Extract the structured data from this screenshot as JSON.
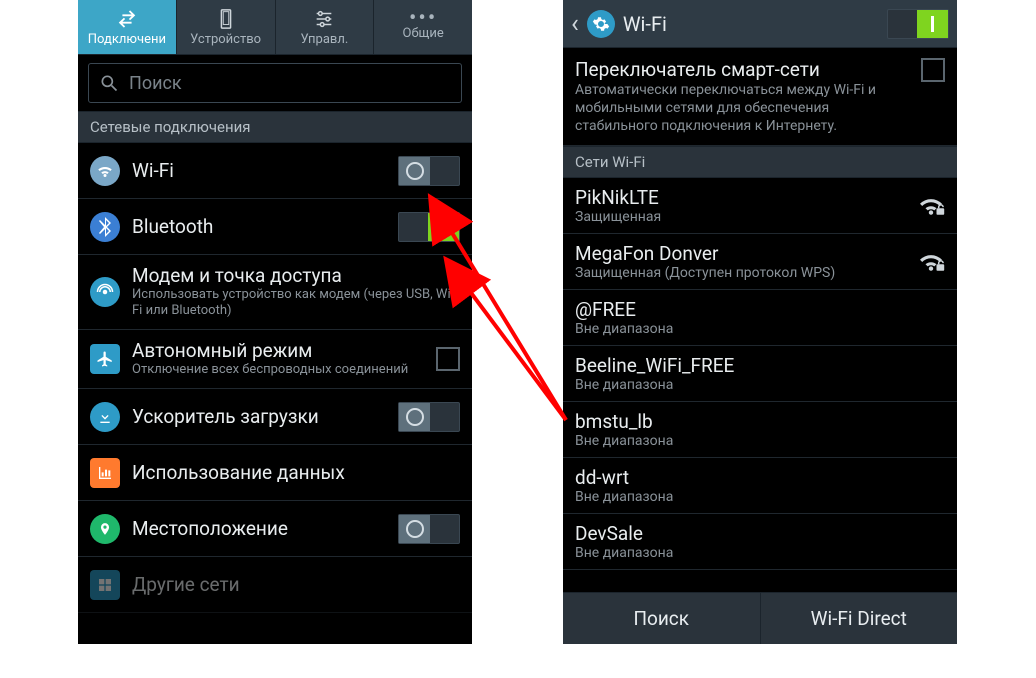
{
  "left": {
    "tabs": [
      {
        "label": "Подключени"
      },
      {
        "label": "Устройство"
      },
      {
        "label": "Управл."
      },
      {
        "label": "Общие"
      }
    ],
    "search_placeholder": "Поиск",
    "section_header": "Сетевые подключения",
    "rows": [
      {
        "title": "Wi-Fi"
      },
      {
        "title": "Bluetooth"
      },
      {
        "title": "Модем и точка доступа",
        "sub": "Использовать устройство как модем (через USB, Wi-Fi или Bluetooth)"
      },
      {
        "title": "Автономный режим",
        "sub": "Отключение всех беспроводных соединений"
      },
      {
        "title": "Ускоритель загрузки"
      },
      {
        "title": "Использование данных"
      },
      {
        "title": "Местоположение"
      },
      {
        "title": "Другие сети"
      }
    ]
  },
  "right": {
    "header_title": "Wi-Fi",
    "smart": {
      "title": "Переключатель смарт-сети",
      "sub": "Автоматически переключаться между Wi-Fi и мобильными сетями для обеспечения стабильного подключения к Интернету."
    },
    "section_header": "Сети Wi-Fi",
    "networks": [
      {
        "name": "PikNikLTE",
        "status": "Защищенная",
        "signal": true
      },
      {
        "name": "MegaFon Donver",
        "status": "Защищенная (Доступен протокол WPS)",
        "signal": true
      },
      {
        "name": "@FREE",
        "status": "Вне диапазона"
      },
      {
        "name": "Beeline_WiFi_FREE",
        "status": "Вне диапазона"
      },
      {
        "name": "bmstu_lb",
        "status": "Вне диапазона"
      },
      {
        "name": "dd-wrt",
        "status": "Вне диапазона"
      },
      {
        "name": "DevSale",
        "status": "Вне диапазона"
      }
    ],
    "bottom": {
      "search": "Поиск",
      "direct": "Wi-Fi Direct"
    }
  },
  "icons": {
    "wifi_circle": "#7aa7c7",
    "bluetooth_circle": "#3b7fd4",
    "tether_circle": "#2e9bc7",
    "airplane_circle": "#2e9bc7",
    "boost_circle": "#2e9bc7",
    "data_square": "#ff7a2e",
    "location_circle": "#1fb86b"
  }
}
